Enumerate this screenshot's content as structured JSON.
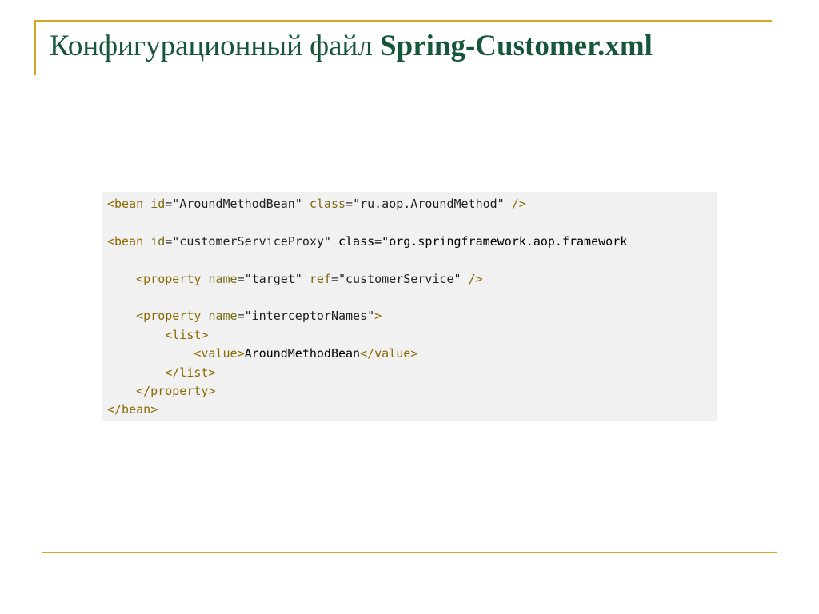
{
  "slide": {
    "title_regular": "Конфигурационный файл ",
    "title_bold": "Spring-Customer.xml",
    "colors": {
      "title": "#16573a",
      "accent_lines": "#d4a62a",
      "code_background": "#f1f1f1",
      "code_tag": "#8b6a00"
    }
  },
  "code": {
    "language": "xml",
    "lines": [
      "<bean id=\"AroundMethodBean\" class=\"ru.aop.AroundMethod\" />",
      "",
      "<bean id=\"customerServiceProxy\" class=\"org.springframework.aop.framework",
      "",
      "    <property name=\"target\" ref=\"customerService\" />",
      "",
      "    <property name=\"interceptorNames\">",
      "        <list>",
      "            <value>AroundMethodBean</value>",
      "        </list>",
      "    </property>",
      "</bean>"
    ]
  }
}
